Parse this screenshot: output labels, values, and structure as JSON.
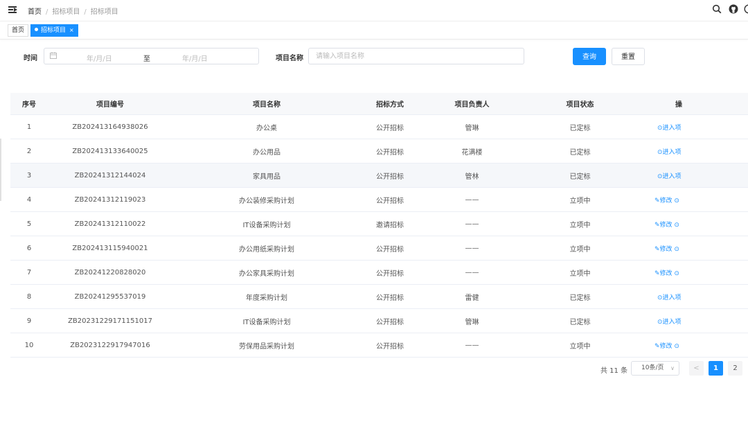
{
  "breadcrumb": {
    "home": "首页",
    "level1": "招标项目",
    "level2": "招标项目"
  },
  "icons": {
    "menu": "menu-fold-icon",
    "search": "search-icon",
    "github": "github-icon",
    "more": "help-circle-icon"
  },
  "tabs": [
    {
      "label": "首页"
    },
    {
      "label": "招标项目",
      "close": "×"
    }
  ],
  "filters": {
    "time_label": "时间",
    "start_placeholder": "年/月/日",
    "range_sep": "至",
    "end_placeholder": "年/月/日",
    "name_label": "项目名称",
    "name_placeholder": "请输入项目名称",
    "query_button": "查询",
    "reset_button": "重置"
  },
  "table": {
    "headers": [
      "序号",
      "项目编号",
      "项目名称",
      "招标方式",
      "项目负责人",
      "项目状态",
      "操"
    ],
    "rows": [
      {
        "no": "1",
        "code": "ZB202413164938026",
        "name": "办公桌",
        "method": "公开招标",
        "owner": "管琳",
        "status": "已定标",
        "action": "⊙进入项"
      },
      {
        "no": "2",
        "code": "ZB202413133640025",
        "name": "办公用品",
        "method": "公开招标",
        "owner": "花满楼",
        "status": "已定标",
        "action": "⊙进入项"
      },
      {
        "no": "3",
        "code": "ZB20241312144024",
        "name": "家具用品",
        "method": "公开招标",
        "owner": "管林",
        "status": "已定标",
        "action": "⊙进入项"
      },
      {
        "no": "4",
        "code": "ZB20241312119023",
        "name": "办公装修采购计划",
        "method": "公开招标",
        "owner": "——",
        "status": "立项中",
        "action": "✎修改 ⊙"
      },
      {
        "no": "5",
        "code": "ZB20241312110022",
        "name": "IT设备采购计划",
        "method": "邀请招标",
        "owner": "——",
        "status": "立项中",
        "action": "✎修改 ⊙"
      },
      {
        "no": "6",
        "code": "ZB202413115940021",
        "name": "办公用纸采购计划",
        "method": "公开招标",
        "owner": "——",
        "status": "立项中",
        "action": "✎修改 ⊙"
      },
      {
        "no": "7",
        "code": "ZB20241220828020",
        "name": "办公家具采购计划",
        "method": "公开招标",
        "owner": "——",
        "status": "立项中",
        "action": "✎修改 ⊙"
      },
      {
        "no": "8",
        "code": "ZB20241295537019",
        "name": "年度采购计划",
        "method": "公开招标",
        "owner": "雷健",
        "status": "已定标",
        "action": "⊙进入项"
      },
      {
        "no": "9",
        "code": "ZB20231229171151017",
        "name": "IT设备采购计划",
        "method": "公开招标",
        "owner": "管琳",
        "status": "已定标",
        "action": "⊙进入项"
      },
      {
        "no": "10",
        "code": "ZB2023122917947016",
        "name": "劳保用品采购计划",
        "method": "公开招标",
        "owner": "——",
        "status": "立项中",
        "action": "✎修改 ⊙"
      }
    ]
  },
  "pagination": {
    "total": "共 11 条",
    "page_size": "10条/页",
    "prev": "<",
    "pages": [
      "1",
      "2"
    ],
    "current": "1"
  },
  "colors": {
    "primary": "#1890ff",
    "header_bg": "#f7f8fa",
    "hover_row": "#f5f7fa"
  }
}
